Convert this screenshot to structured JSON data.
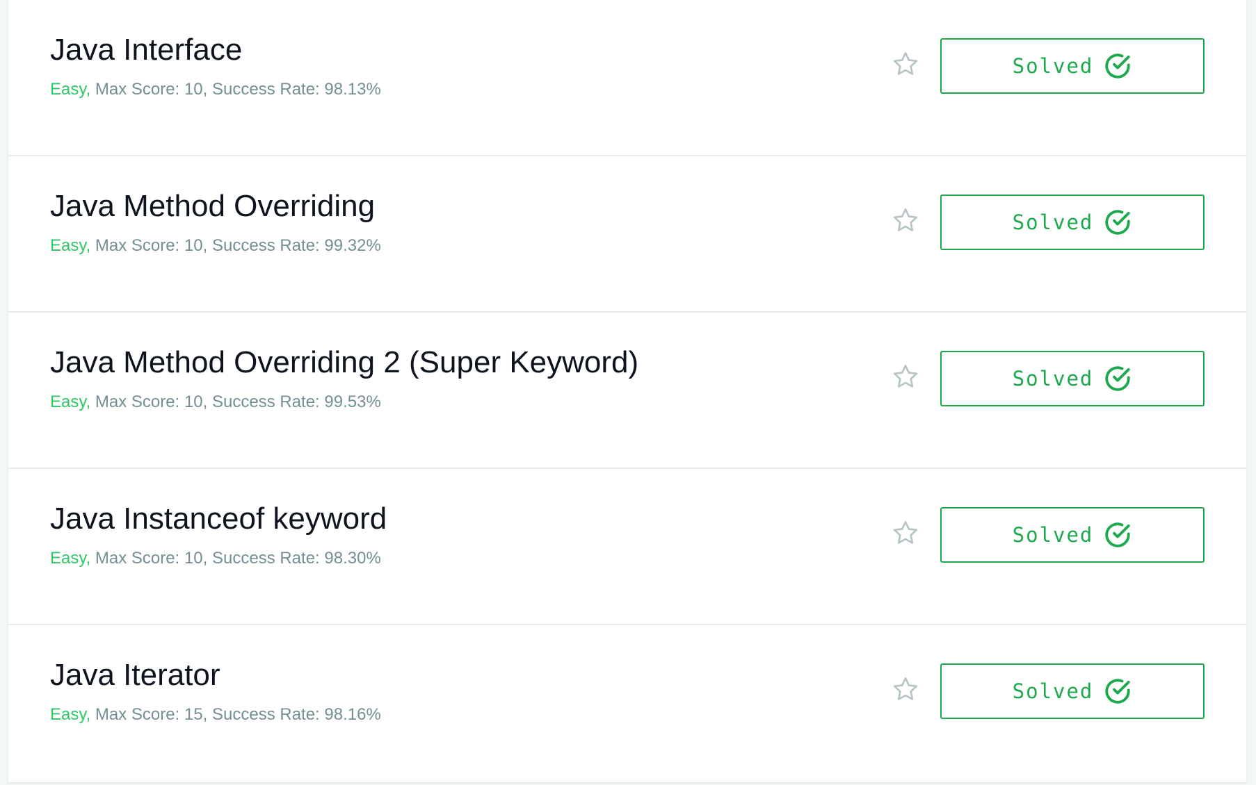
{
  "challenges": [
    {
      "title": "Java Interface",
      "difficulty": "Easy,",
      "details": " Max Score: 10, Success Rate: 98.13%",
      "status": "Solved"
    },
    {
      "title": "Java Method Overriding",
      "difficulty": "Easy,",
      "details": " Max Score: 10, Success Rate: 99.32%",
      "status": "Solved"
    },
    {
      "title": "Java Method Overriding 2 (Super Keyword)",
      "difficulty": "Easy,",
      "details": " Max Score: 10, Success Rate: 99.53%",
      "status": "Solved"
    },
    {
      "title": "Java Instanceof keyword",
      "difficulty": "Easy,",
      "details": " Max Score: 10, Success Rate: 98.30%",
      "status": "Solved"
    },
    {
      "title": "Java Iterator",
      "difficulty": "Easy,",
      "details": " Max Score: 15, Success Rate: 98.16%",
      "status": "Solved"
    }
  ],
  "icons": {
    "bookmark": "star-outline-icon",
    "solved": "check-circle-icon"
  },
  "colors": {
    "difficulty_easy": "#2ec866",
    "solved_accent": "#1ba94c",
    "meta_text": "#738f93",
    "title_text": "#0e141e",
    "star_outline": "#b7c4c6"
  }
}
